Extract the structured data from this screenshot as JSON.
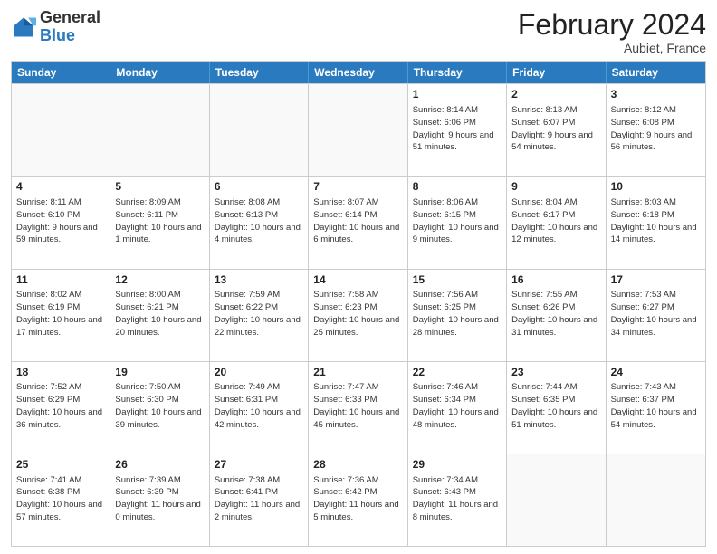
{
  "header": {
    "logo_general": "General",
    "logo_blue": "Blue",
    "month_title": "February 2024",
    "location": "Aubiet, France"
  },
  "days_of_week": [
    "Sunday",
    "Monday",
    "Tuesday",
    "Wednesday",
    "Thursday",
    "Friday",
    "Saturday"
  ],
  "weeks": [
    [
      {
        "day": "",
        "info": ""
      },
      {
        "day": "",
        "info": ""
      },
      {
        "day": "",
        "info": ""
      },
      {
        "day": "",
        "info": ""
      },
      {
        "day": "1",
        "info": "Sunrise: 8:14 AM\nSunset: 6:06 PM\nDaylight: 9 hours and 51 minutes."
      },
      {
        "day": "2",
        "info": "Sunrise: 8:13 AM\nSunset: 6:07 PM\nDaylight: 9 hours and 54 minutes."
      },
      {
        "day": "3",
        "info": "Sunrise: 8:12 AM\nSunset: 6:08 PM\nDaylight: 9 hours and 56 minutes."
      }
    ],
    [
      {
        "day": "4",
        "info": "Sunrise: 8:11 AM\nSunset: 6:10 PM\nDaylight: 9 hours and 59 minutes."
      },
      {
        "day": "5",
        "info": "Sunrise: 8:09 AM\nSunset: 6:11 PM\nDaylight: 10 hours and 1 minute."
      },
      {
        "day": "6",
        "info": "Sunrise: 8:08 AM\nSunset: 6:13 PM\nDaylight: 10 hours and 4 minutes."
      },
      {
        "day": "7",
        "info": "Sunrise: 8:07 AM\nSunset: 6:14 PM\nDaylight: 10 hours and 6 minutes."
      },
      {
        "day": "8",
        "info": "Sunrise: 8:06 AM\nSunset: 6:15 PM\nDaylight: 10 hours and 9 minutes."
      },
      {
        "day": "9",
        "info": "Sunrise: 8:04 AM\nSunset: 6:17 PM\nDaylight: 10 hours and 12 minutes."
      },
      {
        "day": "10",
        "info": "Sunrise: 8:03 AM\nSunset: 6:18 PM\nDaylight: 10 hours and 14 minutes."
      }
    ],
    [
      {
        "day": "11",
        "info": "Sunrise: 8:02 AM\nSunset: 6:19 PM\nDaylight: 10 hours and 17 minutes."
      },
      {
        "day": "12",
        "info": "Sunrise: 8:00 AM\nSunset: 6:21 PM\nDaylight: 10 hours and 20 minutes."
      },
      {
        "day": "13",
        "info": "Sunrise: 7:59 AM\nSunset: 6:22 PM\nDaylight: 10 hours and 22 minutes."
      },
      {
        "day": "14",
        "info": "Sunrise: 7:58 AM\nSunset: 6:23 PM\nDaylight: 10 hours and 25 minutes."
      },
      {
        "day": "15",
        "info": "Sunrise: 7:56 AM\nSunset: 6:25 PM\nDaylight: 10 hours and 28 minutes."
      },
      {
        "day": "16",
        "info": "Sunrise: 7:55 AM\nSunset: 6:26 PM\nDaylight: 10 hours and 31 minutes."
      },
      {
        "day": "17",
        "info": "Sunrise: 7:53 AM\nSunset: 6:27 PM\nDaylight: 10 hours and 34 minutes."
      }
    ],
    [
      {
        "day": "18",
        "info": "Sunrise: 7:52 AM\nSunset: 6:29 PM\nDaylight: 10 hours and 36 minutes."
      },
      {
        "day": "19",
        "info": "Sunrise: 7:50 AM\nSunset: 6:30 PM\nDaylight: 10 hours and 39 minutes."
      },
      {
        "day": "20",
        "info": "Sunrise: 7:49 AM\nSunset: 6:31 PM\nDaylight: 10 hours and 42 minutes."
      },
      {
        "day": "21",
        "info": "Sunrise: 7:47 AM\nSunset: 6:33 PM\nDaylight: 10 hours and 45 minutes."
      },
      {
        "day": "22",
        "info": "Sunrise: 7:46 AM\nSunset: 6:34 PM\nDaylight: 10 hours and 48 minutes."
      },
      {
        "day": "23",
        "info": "Sunrise: 7:44 AM\nSunset: 6:35 PM\nDaylight: 10 hours and 51 minutes."
      },
      {
        "day": "24",
        "info": "Sunrise: 7:43 AM\nSunset: 6:37 PM\nDaylight: 10 hours and 54 minutes."
      }
    ],
    [
      {
        "day": "25",
        "info": "Sunrise: 7:41 AM\nSunset: 6:38 PM\nDaylight: 10 hours and 57 minutes."
      },
      {
        "day": "26",
        "info": "Sunrise: 7:39 AM\nSunset: 6:39 PM\nDaylight: 11 hours and 0 minutes."
      },
      {
        "day": "27",
        "info": "Sunrise: 7:38 AM\nSunset: 6:41 PM\nDaylight: 11 hours and 2 minutes."
      },
      {
        "day": "28",
        "info": "Sunrise: 7:36 AM\nSunset: 6:42 PM\nDaylight: 11 hours and 5 minutes."
      },
      {
        "day": "29",
        "info": "Sunrise: 7:34 AM\nSunset: 6:43 PM\nDaylight: 11 hours and 8 minutes."
      },
      {
        "day": "",
        "info": ""
      },
      {
        "day": "",
        "info": ""
      }
    ]
  ]
}
